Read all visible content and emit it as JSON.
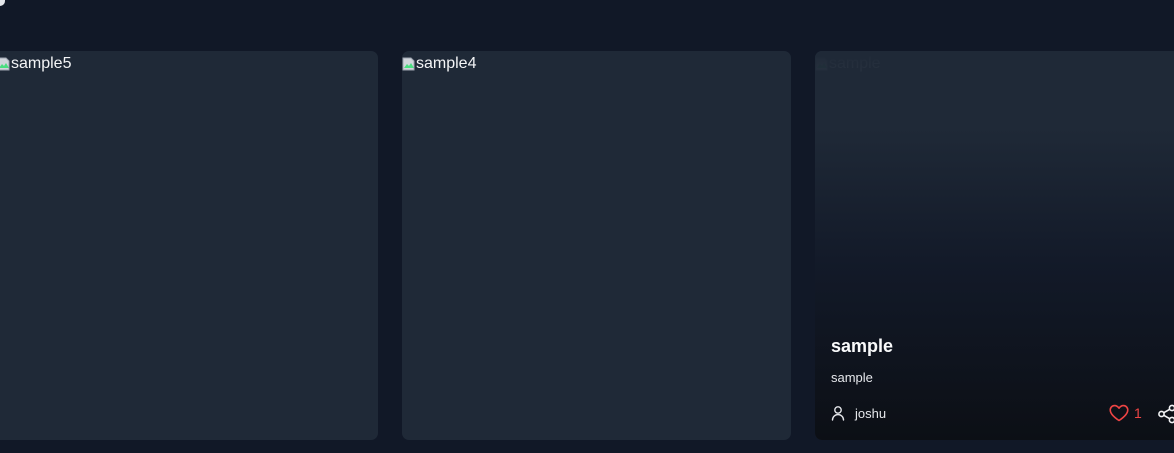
{
  "cards": [
    {
      "image_alt": "sample5"
    },
    {
      "image_alt": "sample4"
    },
    {
      "image_alt": "sample",
      "title": "sample",
      "description": "sample",
      "author": "joshu",
      "likes": "1"
    }
  ],
  "icons": {
    "author": "user-icon",
    "like": "heart-icon",
    "share": "share-icon",
    "broken_image": "broken-image-icon"
  },
  "colors": {
    "background": "#111827",
    "card": "#1f2937",
    "like": "#ef4444",
    "text": "#f9fafb"
  }
}
